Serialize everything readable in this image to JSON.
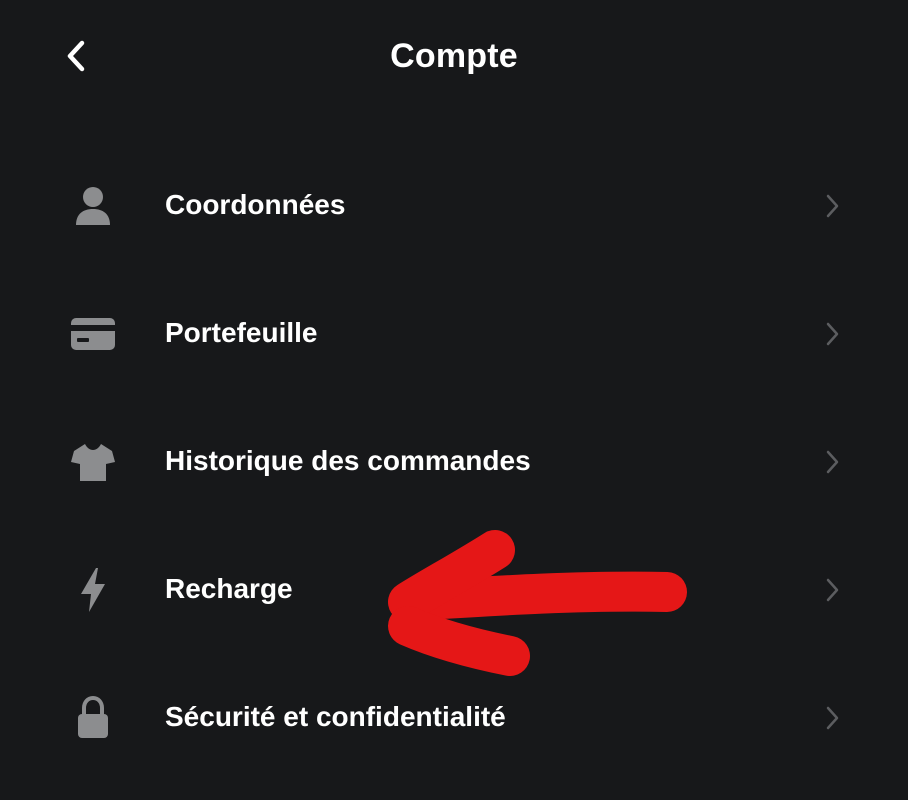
{
  "header": {
    "title": "Compte",
    "back_icon": "chevron-left-icon"
  },
  "menu": {
    "items": [
      {
        "label": "Coordonnées",
        "icon": "person-icon"
      },
      {
        "label": "Portefeuille",
        "icon": "credit-card-icon"
      },
      {
        "label": "Historique des commandes",
        "icon": "tshirt-icon"
      },
      {
        "label": "Recharge",
        "icon": "lightning-bolt-icon"
      },
      {
        "label": "Sécurité et confidentialité",
        "icon": "lock-icon"
      }
    ]
  },
  "colors": {
    "background": "#17181a",
    "text": "#ffffff",
    "icon": "#8c8d8f",
    "chevron": "#5c5d60",
    "annotation_arrow": "#e51717"
  }
}
